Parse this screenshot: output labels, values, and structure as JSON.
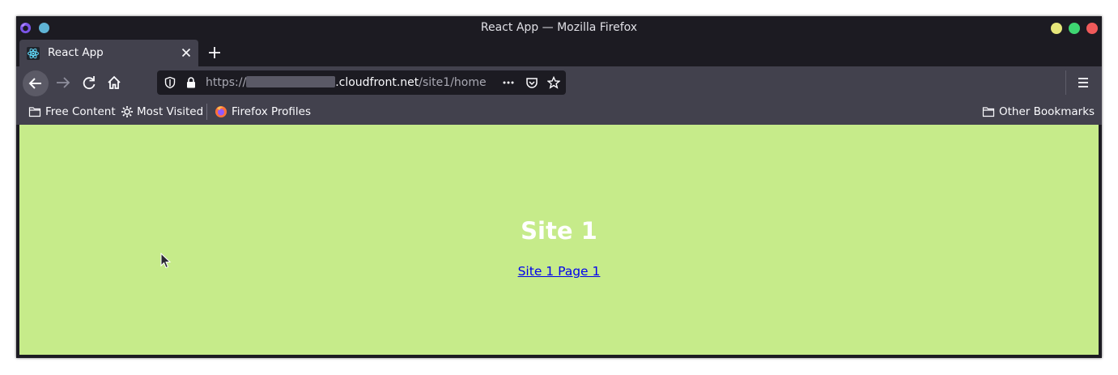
{
  "window": {
    "title": "React App — Mozilla Firefox"
  },
  "tabs": [
    {
      "title": "React App",
      "favicon": "react-icon",
      "active": true
    }
  ],
  "toolbar": {
    "url_scheme": "https://",
    "url_host": ".cloudfront.net",
    "url_path": "/site1/home"
  },
  "bookmarks": {
    "items": [
      {
        "label": "Free Content",
        "icon": "folder-icon"
      },
      {
        "label": "Most Visited",
        "icon": "gear-icon"
      },
      {
        "label": "Firefox Profiles",
        "icon": "firefox-icon"
      }
    ],
    "other": {
      "label": "Other Bookmarks",
      "icon": "folder-icon"
    }
  },
  "page": {
    "heading": "Site 1",
    "link_label": "Site 1 Page 1",
    "background": "#c6eb8a",
    "link_color": "#0000ee"
  },
  "colors": {
    "titlebar": "#1c1b22",
    "toolbar": "#42414d",
    "urlbar": "#1c1b22"
  }
}
